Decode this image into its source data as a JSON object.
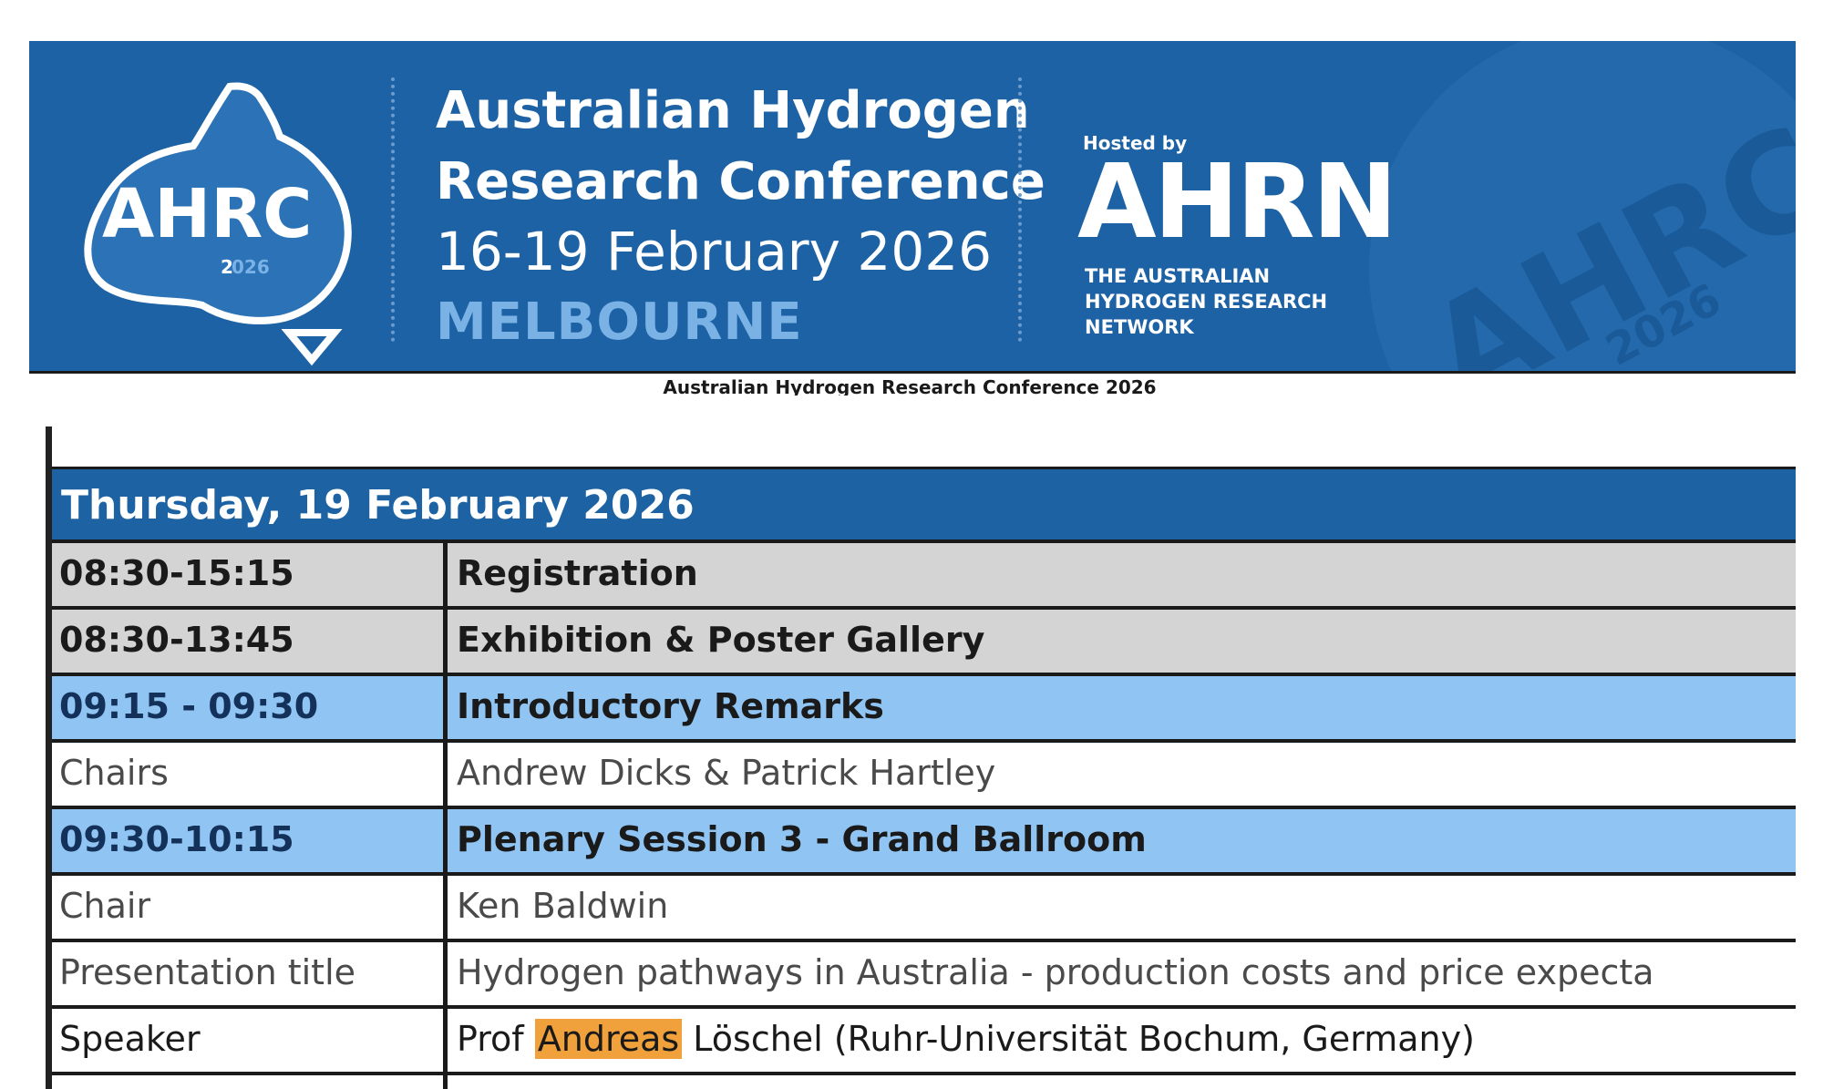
{
  "banner": {
    "logo_text": "AHRC",
    "logo_year_a": "2",
    "logo_year_b": "026",
    "title_line1": "Australian Hydrogen",
    "title_line2": "Research Conference",
    "dates": "16-19 February 2026",
    "city": "MELBOURNE",
    "hosted_by": "Hosted by",
    "host_name": "AHRN",
    "host_line1": "THE AUSTRALIAN",
    "host_line2": "HYDROGEN RESEARCH",
    "host_line3": "NETWORK",
    "watermark_text": "AHRC",
    "watermark_year": "2026",
    "colors": {
      "background": "#1c62a4",
      "accent": "#7ab2e6"
    }
  },
  "caption": "Australian Hydrogen Research Conference 2026",
  "schedule": {
    "day": "Thursday, 19 February 2026",
    "rows": [
      {
        "time": "08:30-15:15",
        "title": "Registration",
        "style": "gray"
      },
      {
        "time": "08:30-13:45",
        "title": "Exhibition & Poster Gallery",
        "style": "gray"
      },
      {
        "time": "09:15 - 09:30",
        "title": "Introductory Remarks",
        "style": "blue"
      },
      {
        "time": "Chairs",
        "title": "Andrew Dicks & Patrick Hartley",
        "style": "white"
      },
      {
        "time": "09:30-10:15",
        "title": "Plenary Session 3 - Grand Ballroom",
        "style": "blue"
      },
      {
        "time": "Chair",
        "title": "Ken Baldwin",
        "style": "white"
      },
      {
        "time": "Presentation title",
        "title": "Hydrogen pathways in Australia - production costs and price expecta",
        "style": "white"
      },
      {
        "time": "Speaker",
        "title_prefix": "Prof ",
        "title_highlight": "Andreas",
        "title_suffix": " Löschel (Ruhr-Universität Bochum, Germany)",
        "style": "white-strong"
      }
    ],
    "colors": {
      "header": "#1d62a3",
      "gray_row": "#d4d4d4",
      "blue_row": "#8fc4f3",
      "highlight": "#f0a13c"
    }
  }
}
